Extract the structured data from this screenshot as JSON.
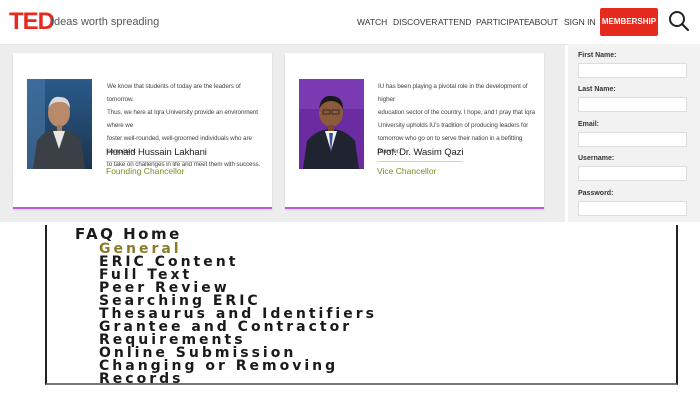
{
  "header": {
    "logo": "TED",
    "tagline": "Ideas worth spreading",
    "nav": [
      "WATCH",
      "DISCOVER",
      "ATTEND",
      "PARTICIPATE",
      "ABOUT",
      "SIGN IN"
    ],
    "membership_label": "MEMBERSHIP",
    "search_icon": "search-icon"
  },
  "cards": [
    {
      "quote_lines": [
        "We know that students of today are the leaders of tomorrow.",
        "Thus, we here at Iqra University provide an environment where we",
        "foster well-rounded, well-groomed individuals who are competent",
        "to take on challenges in life and meet them with success."
      ],
      "name": "Hunaid Hussain Lakhani",
      "role": "Founding Chancellor"
    },
    {
      "quote_lines": [
        "IU has been playing a pivotal role in the development of higher",
        "education sector of the country. I hope, and I pray that Iqra",
        "University upholds IU's tradition of producing leaders for",
        "tomorrow who go on to serve their nation in a befitting manner."
      ],
      "name": "Prof. Dr. Wasim Qazi",
      "role": "Vice Chancellor"
    }
  ],
  "signin_form": {
    "labels": [
      "First Name:",
      "Last Name:",
      "Email:",
      "Username:",
      "Password:"
    ]
  },
  "faq": {
    "title": "FAQ Home",
    "items": [
      "General",
      "ERIC Content",
      "Full Text",
      "Peer Review",
      "Searching ERIC",
      "Thesaurus and Identifiers",
      "Grantee and Contractor",
      "Requirements",
      "Online Submission",
      "Changing or Removing",
      "Records"
    ],
    "active_index": 0
  },
  "colors": {
    "brand_red": "#e62b1e",
    "card_accent": "#b45fd6",
    "role_text": "#7a8a1e",
    "faq_active": "#8a7a2a"
  }
}
